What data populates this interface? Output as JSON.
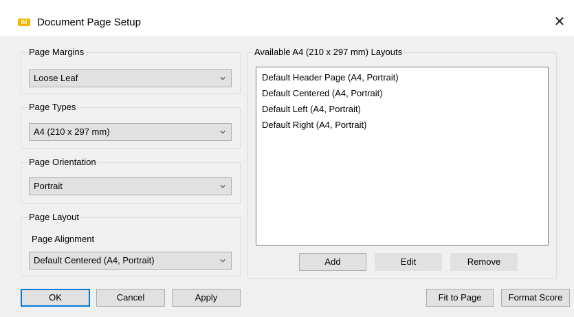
{
  "window": {
    "title": "Document Page Setup",
    "icon": "app-logo-icon",
    "close_glyph": "✕"
  },
  "page_margins": {
    "label": "Page Margins",
    "value": "Loose Leaf"
  },
  "page_types": {
    "label": "Page Types",
    "value": "A4 (210 x 297 mm)"
  },
  "page_orientation": {
    "label": "Page Orientation",
    "value": "Portrait"
  },
  "page_layout": {
    "label": "Page Layout",
    "alignment_label": "Page Alignment",
    "value": "Default Centered (A4, Portrait)"
  },
  "layouts": {
    "label": "Available A4 (210 x 297 mm) Layouts",
    "items": [
      "Default Header Page (A4, Portrait)",
      "Default Centered (A4, Portrait)",
      "Default Left (A4, Portrait)",
      "Default Right (A4, Portrait)"
    ],
    "add_label": "Add",
    "edit_label": "Edit",
    "remove_label": "Remove"
  },
  "footer": {
    "ok_label": "OK",
    "cancel_label": "Cancel",
    "apply_label": "Apply",
    "fit_label": "Fit to Page",
    "format_label": "Format Score"
  },
  "colors": {
    "accent": "#0078d7",
    "button": "#e1e1e1",
    "background": "#f0f0f0",
    "icon": "#f5b800"
  }
}
